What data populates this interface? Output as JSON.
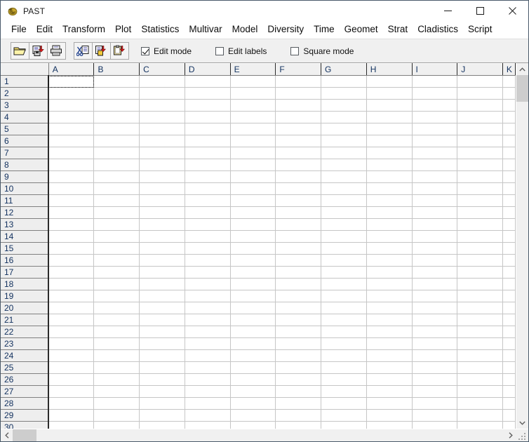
{
  "window": {
    "title": "PAST",
    "icon": "ammonite-fossil-icon",
    "controls": {
      "minimize": "–",
      "maximize": "□",
      "close": "✕"
    }
  },
  "menubar": {
    "items": [
      {
        "label": "File"
      },
      {
        "label": "Edit"
      },
      {
        "label": "Transform"
      },
      {
        "label": "Plot"
      },
      {
        "label": "Statistics"
      },
      {
        "label": "Multivar"
      },
      {
        "label": "Model"
      },
      {
        "label": "Diversity"
      },
      {
        "label": "Time"
      },
      {
        "label": "Geomet"
      },
      {
        "label": "Strat"
      },
      {
        "label": "Cladistics"
      },
      {
        "label": "Script"
      }
    ]
  },
  "toolbar": {
    "buttons": [
      {
        "name": "open-file-button",
        "icon": "open-folder-icon"
      },
      {
        "name": "save-file-button",
        "icon": "save-disk-icon"
      },
      {
        "name": "print-button",
        "icon": "printer-icon"
      },
      {
        "name": "cut-button",
        "icon": "scissors-icon"
      },
      {
        "name": "copy-button",
        "icon": "copy-icon"
      },
      {
        "name": "paste-button",
        "icon": "paste-clipboard-icon"
      }
    ],
    "checkboxes": [
      {
        "name": "edit-mode-checkbox",
        "label": "Edit mode",
        "checked": true
      },
      {
        "name": "edit-labels-checkbox",
        "label": "Edit labels",
        "checked": false
      },
      {
        "name": "square-mode-checkbox",
        "label": "Square mode",
        "checked": false
      }
    ]
  },
  "sheet": {
    "columns": [
      "A",
      "B",
      "C",
      "D",
      "E",
      "F",
      "G",
      "H",
      "I",
      "J",
      "K"
    ],
    "rows": [
      "1",
      "2",
      "3",
      "4",
      "5",
      "6",
      "7",
      "8",
      "9",
      "10",
      "11",
      "12",
      "13",
      "14",
      "15",
      "16",
      "17",
      "18",
      "19",
      "20",
      "21",
      "22",
      "23",
      "24",
      "25",
      "26",
      "27",
      "28",
      "29",
      "30"
    ],
    "focused_cell": "A1",
    "cell_values": []
  },
  "scrollbars": {
    "vertical": {
      "up_arrow": "⌃",
      "down_arrow": "⌄"
    },
    "horizontal": {
      "left_arrow": "‹",
      "right_arrow": "›"
    }
  },
  "colors": {
    "header_bg": "#f0f0f0",
    "header_text": "#11305e",
    "grid_line": "#c6c6c6",
    "toolbar_bg": "#f0f0f0",
    "scrollbar_thumb": "#cdcdcd",
    "window_border": "#4a5a6a"
  }
}
